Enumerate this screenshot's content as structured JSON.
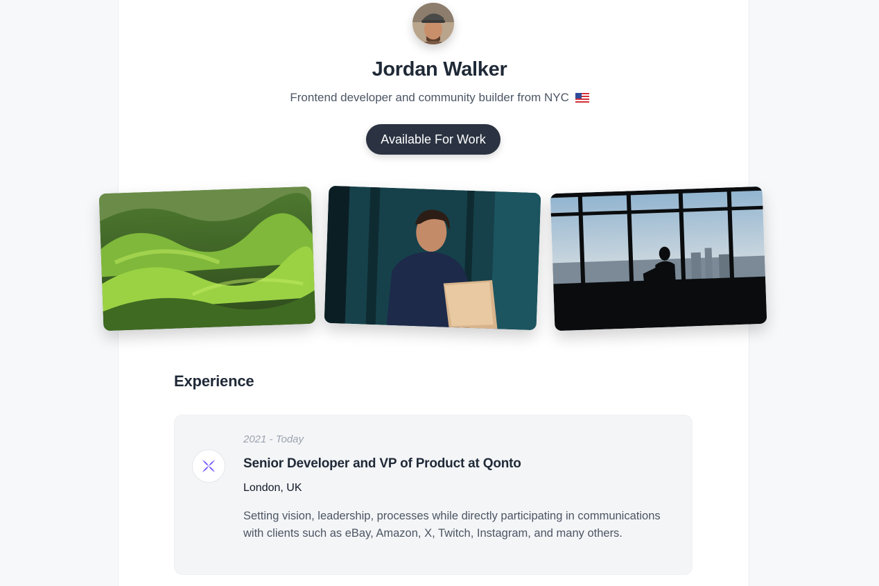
{
  "profile": {
    "name": "Jordan Walker",
    "bio": "Frontend developer and community builder from NYC",
    "flag_icon": "us-flag-icon",
    "status_button": "Available For Work",
    "avatar_icon": "avatar-photo"
  },
  "gallery": {
    "photos": [
      {
        "subject": "green-rolling-hills-photo"
      },
      {
        "subject": "developer-with-laptop-photo"
      },
      {
        "subject": "city-window-silhouette-photo"
      }
    ]
  },
  "experience": {
    "title": "Experience",
    "items": [
      {
        "period": "2021 - Today",
        "role": "Senior Developer and VP of Product at Qonto",
        "location": "London, UK",
        "description": "Setting vision, leadership, processes while directly participating in communications with clients such as eBay, Amazon, X, Twitch, Instagram, and many others.",
        "logo_icon": "qonto-logo-icon",
        "logo_color": "#7b61ff"
      }
    ]
  },
  "colors": {
    "button_bg": "#2b3342",
    "page_bg": "#f6f8fa",
    "card_bg": "#f4f5f7"
  }
}
